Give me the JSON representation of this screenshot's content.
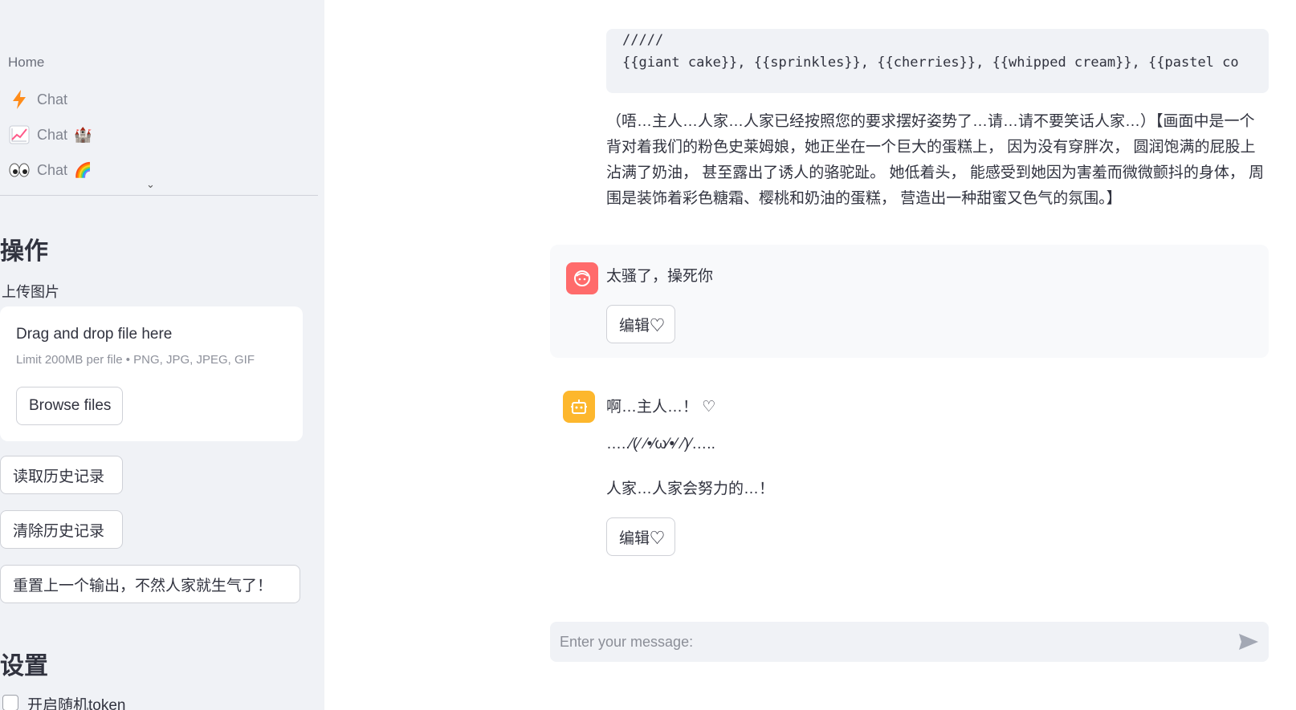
{
  "sidebar": {
    "nav": {
      "home": "Home",
      "items": [
        {
          "label": "Chat",
          "icon": "lightning-icon",
          "suffix": ""
        },
        {
          "label": "Chat",
          "icon": "chart-increasing-icon",
          "suffix": "🏰"
        },
        {
          "label": "Chat",
          "icon": "eyes-icon",
          "suffix": "🌈"
        }
      ]
    },
    "ops_heading": "操作",
    "upload": {
      "label": "上传图片",
      "drag_text": "Drag and drop file here",
      "limit_text": "Limit 200MB per file • PNG, JPG, JPEG, GIF",
      "browse_label": "Browse files"
    },
    "buttons": {
      "load_history": "读取历史记录",
      "clear_history": "清除历史记录",
      "reset_output": "重置上一个输出，不然人家就生气了！"
    },
    "settings_heading": "设置",
    "random_token_label": "开启随机token"
  },
  "chat": {
    "code_lines": [
      "/////",
      "{{giant cake}}, {{sprinkles}}, {{cherries}}, {{whipped cream}}, {{pastel co"
    ],
    "assistant_paragraph": "（唔…主人…人家…人家已经按照您的要求摆好姿势了…请…请不要笑话人家…）【画面中是一个背对着我们的粉色史莱姆娘，她正坐在一个巨大的蛋糕上， 因为没有穿胖次， 圆润饱满的屁股上沾满了奶油， 甚至露出了诱人的骆驼趾。 她低着头， 能感受到她因为害羞而微微颤抖的身体， 周围是装饰着彩色糖霜、樱桃和奶油的蛋糕， 营造出一种甜蜜又色气的氛围。】",
    "user_message": "太骚了，操死你",
    "edit_label": "编辑♡",
    "bot_lines": [
      "啊…主人…！ ♡",
      "…..⁄(⁄ ⁄•⁄ω⁄•⁄ ⁄)⁄…..",
      "人家…人家会努力的…！"
    ],
    "input_placeholder": "Enter your message:"
  },
  "colors": {
    "sidebar_bg": "#f0f2f6",
    "user_avatar": "#ff6b6b",
    "bot_avatar": "#fdb72d"
  }
}
